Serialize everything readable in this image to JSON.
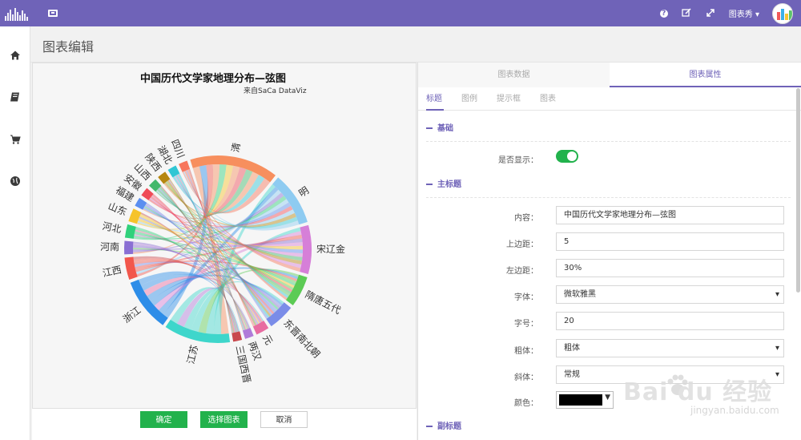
{
  "topbar": {
    "user_name": "图表秀 ▾"
  },
  "sidebar": {
    "items": [
      {
        "icon": "home-icon"
      },
      {
        "icon": "book-icon"
      },
      {
        "icon": "cart-icon"
      },
      {
        "icon": "globe-icon"
      }
    ]
  },
  "page": {
    "title": "图表编辑"
  },
  "chart": {
    "title": "中国历代文学家地理分布—弦图",
    "subtitle": "来自SaCa DataViz",
    "segment_labels": [
      "清",
      "明",
      "宋辽金",
      "隋唐五代",
      "东晋南北朝",
      "元",
      "两汉",
      "三国西晋",
      "江苏",
      "浙江",
      "江西",
      "河南",
      "河北",
      "山东",
      "福建",
      "安徽",
      "山西",
      "陕西",
      "湖北",
      "四川"
    ],
    "segment_colors": [
      "#f78f5e",
      "#8ecbf1",
      "#d67fd8",
      "#5ccb55",
      "#7a8ce8",
      "#e86ca1",
      "#b07bd9",
      "#c9494e",
      "#3ed6cb",
      "#2d8de8",
      "#f2574c",
      "#8a6fd3",
      "#30d17b",
      "#f6c32a",
      "#5b8ff0",
      "#ef4b57",
      "#43b86b",
      "#b58710",
      "#2fc6d4",
      "#f7765c"
    ]
  },
  "chart_data": {
    "type": "chord",
    "title": "中国历代文学家地理分布—弦图",
    "subtitle": "来自SaCa DataViz",
    "groups": [
      "清",
      "明",
      "宋辽金",
      "隋唐五代",
      "东晋南北朝",
      "元",
      "两汉",
      "三国西晋",
      "江苏",
      "浙江",
      "江西",
      "河南",
      "河北",
      "山东",
      "福建",
      "安徽",
      "山西",
      "陕西",
      "湖北",
      "四川"
    ],
    "arc_sizes": [
      20,
      12,
      11,
      7,
      6,
      3,
      2,
      2,
      15,
      12,
      5,
      3,
      3,
      3,
      2,
      2,
      2,
      2,
      2,
      2
    ]
  },
  "buttons": {
    "confirm": "确定",
    "select_chart": "选择图表",
    "cancel": "取消"
  },
  "panel": {
    "top_tabs": [
      "图表数据",
      "图表属性"
    ],
    "sub_tabs": [
      "标题",
      "图例",
      "提示框",
      "图表"
    ],
    "section_basic": "基础",
    "show_label": "是否显示：",
    "section_main_title": "主标题",
    "content_label": "内容：",
    "content_value": "中国历代文学家地理分布—弦图",
    "top_margin_label": "上边距：",
    "top_margin_value": "5",
    "left_margin_label": "左边距：",
    "left_margin_value": "30%",
    "font_label": "字体：",
    "font_value": "微软雅黑",
    "size_label": "字号：",
    "size_value": "20",
    "bold_label": "粗体：",
    "bold_value": "粗体",
    "italic_label": "斜体：",
    "italic_value": "常规",
    "color_label": "颜色：",
    "color_value": "#000000",
    "section_subtitle": "副标题"
  },
  "watermark": {
    "main": "Bai  du 经验",
    "sub": "jingyan.baidu.com"
  }
}
